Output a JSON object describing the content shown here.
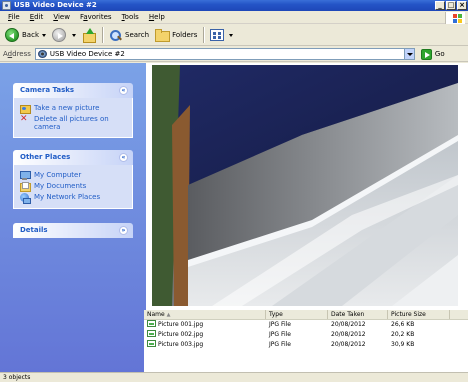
{
  "window": {
    "title": "USB Video Device #2",
    "minimize": "_",
    "maximize": "□",
    "close": "×"
  },
  "menu": [
    {
      "acc": "F",
      "rest": "ile"
    },
    {
      "acc": "E",
      "rest": "dit"
    },
    {
      "acc": "V",
      "rest": "iew"
    },
    {
      "pre": "F",
      "acc": "a",
      "rest": "vorites"
    },
    {
      "acc": "T",
      "rest": "ools"
    },
    {
      "acc": "H",
      "rest": "elp"
    }
  ],
  "toolbar": {
    "back": "Back",
    "search": "Search",
    "folders": "Folders"
  },
  "address": {
    "label_acc": "d",
    "label_pre": "A",
    "label_rest": "dress",
    "value": "USB Video Device #2",
    "go": "Go"
  },
  "tasks": {
    "camera": {
      "title": "Camera Tasks",
      "items": [
        "Take a new picture",
        "Delete all pictures on camera"
      ]
    },
    "places": {
      "title": "Other Places",
      "items": [
        "My Computer",
        "My Documents",
        "My Network Places"
      ]
    },
    "details": {
      "title": "Details"
    }
  },
  "files": {
    "columns": [
      "Name",
      "Type",
      "Date Taken",
      "Picture Size"
    ],
    "sort_indicator": "▲",
    "rows": [
      {
        "name": "Picture 001.jpg",
        "type": "JPG File",
        "date": "20/08/2012",
        "size": "26,6 KB"
      },
      {
        "name": "Picture 002.jpg",
        "type": "JPG File",
        "date": "20/08/2012",
        "size": "20,2 KB"
      },
      {
        "name": "Picture 003.jpg",
        "type": "JPG File",
        "date": "20/08/2012",
        "size": "30,9 KB"
      }
    ]
  },
  "status": {
    "text": "3 objects"
  },
  "chevrons": {
    "up": "«",
    "down": "»"
  }
}
